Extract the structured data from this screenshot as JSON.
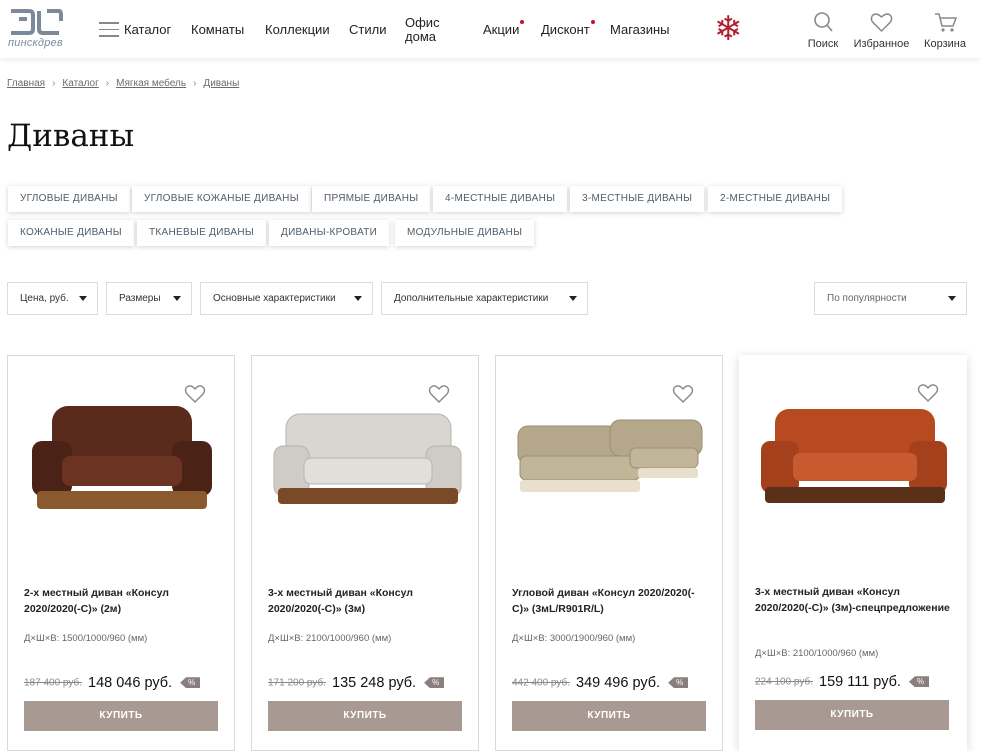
{
  "header": {
    "logo_text": "пинскдрев",
    "nav": [
      {
        "label": "Каталог"
      },
      {
        "label": "Комнаты"
      },
      {
        "label": "Коллекции"
      },
      {
        "label": "Стили"
      },
      {
        "label": "Офис дома"
      },
      {
        "label": "Акции"
      },
      {
        "label": "Дисконт"
      },
      {
        "label": "Магазины"
      }
    ],
    "icons": [
      {
        "label": "Поиск",
        "icon": "search-icon"
      },
      {
        "label": "Избранное",
        "icon": "heart-icon"
      },
      {
        "label": "Корзина",
        "icon": "cart-icon"
      }
    ],
    "accent_color": "#c8102e"
  },
  "breadcrumb": [
    "Главная",
    "Каталог",
    "Мягкая мебель",
    "Диваны"
  ],
  "page_title": "Диваны",
  "tags": [
    "Угловые диваны",
    "Угловые кожаные диваны",
    "Прямые диваны",
    "4-местные диваны",
    "3-местные диваны",
    "2-местные диваны",
    "Кожаные диваны",
    "Тканевые диваны",
    "Диваны-кровати",
    "Модульные диваны"
  ],
  "filters": [
    "Цена, руб.",
    "Размеры",
    "Основные характеристики",
    "Дополнительные характеристики"
  ],
  "sort": {
    "selected": "По популярности"
  },
  "products": [
    {
      "name": "2-х местный диван «Консул 2020/2020(-С)» (2м)",
      "dims": "Д×Ш×В: 1500/1000/960 (мм)",
      "old_price": "187 400 руб.",
      "price": "148 046 руб.",
      "badge": "%",
      "buy": "КУПИТЬ",
      "color": "#5a2a1c"
    },
    {
      "name": "3-х местный диван «Консул 2020/2020(-С)» (3м)",
      "dims": "Д×Ш×В: 2100/1000/960 (мм)",
      "old_price": "171 200 руб.",
      "price": "135 248 руб.",
      "badge": "%",
      "buy": "КУПИТЬ",
      "color": "#d9d6d2"
    },
    {
      "name": "Угловой диван «Консул 2020/2020(-С)» (3мL/R901R/L)",
      "dims": "Д×Ш×В: 3000/1900/960 (мм)",
      "old_price": "442 400 руб.",
      "price": "349 496 руб.",
      "badge": "%",
      "buy": "КУПИТЬ",
      "color": "#b5a88a"
    },
    {
      "name": "3-х местный диван «Консул 2020/2020(-С)» (3м)-спецпредложение",
      "dims": "Д×Ш×В: 2100/1000/960 (мм)",
      "old_price": "224 100 руб.",
      "price": "159 111 руб.",
      "badge": "%",
      "buy": "КУПИТЬ",
      "color": "#b84a22"
    }
  ]
}
